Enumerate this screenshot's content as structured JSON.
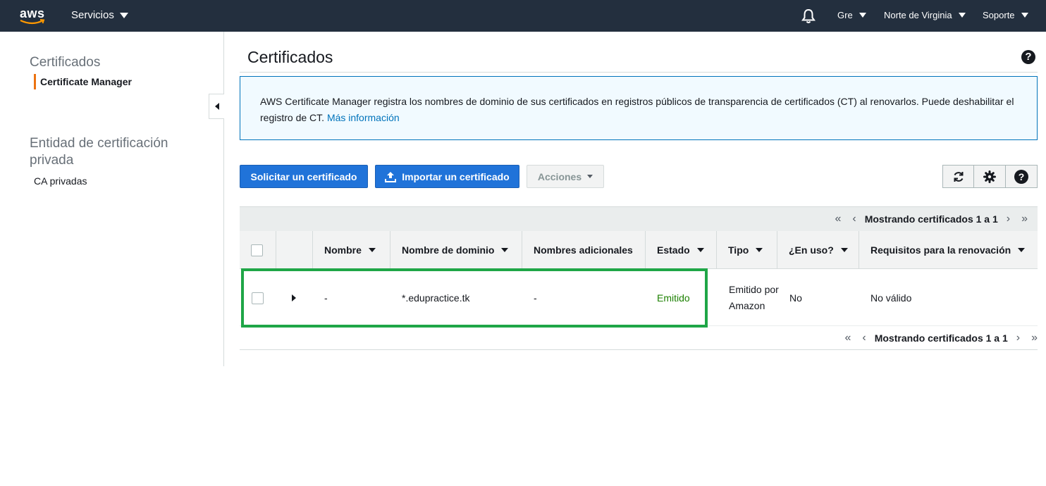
{
  "topnav": {
    "logo": "aws",
    "services_label": "Servicios",
    "account_label": "Gre",
    "region_label": "Norte de Virginia",
    "support_label": "Soporte"
  },
  "sidebar": {
    "section1_title": "Certificados",
    "section1_items": [
      "Certificate Manager"
    ],
    "section2_title": "Entidad de certificación privada",
    "section2_items": [
      "CA privadas"
    ]
  },
  "main": {
    "title": "Certificados",
    "info_text": "AWS Certificate Manager registra los nombres de dominio de sus certificados en registros públicos de transparencia de certificados (CT) al renovarlos. Puede deshabilitar el registro de CT.",
    "info_link": "Más información",
    "buttons": {
      "request": "Solicitar un certificado",
      "import": "Importar un certificado",
      "actions": "Acciones"
    },
    "pager_text": "Mostrando certificados 1 a 1",
    "columns": [
      "Nombre",
      "Nombre de dominio",
      "Nombres adicionales",
      "Estado",
      "Tipo",
      "¿En uso?",
      "Requisitos para la renovación"
    ],
    "rows": [
      {
        "name": "-",
        "domain": "*.edupractice.tk",
        "additional": "-",
        "status": "Emitido",
        "type": "Emitido por Amazon",
        "in_use": "No",
        "renewal": "No válido"
      }
    ]
  },
  "colors": {
    "nav_bg": "#232f3e",
    "primary": "#2073d9",
    "link": "#0073bb",
    "success": "#1d8102",
    "highlight": "#1fa647",
    "accent": "#ec7211"
  }
}
